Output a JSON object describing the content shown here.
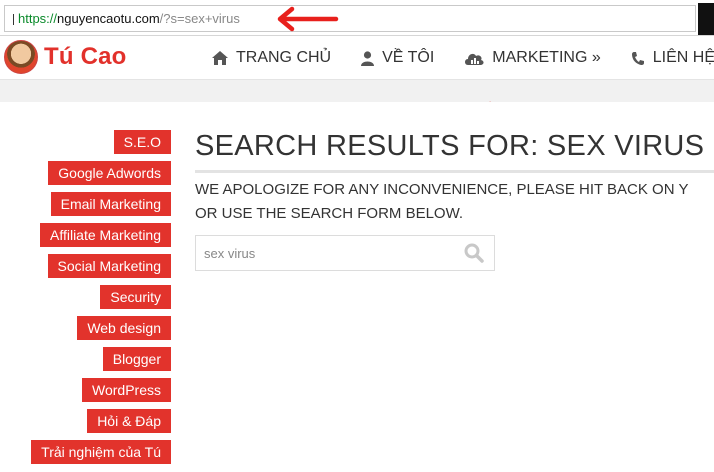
{
  "address_bar": {
    "scheme": "https://",
    "url_main": "nguyencaotu.com",
    "url_rest": "/?s=sex+virus"
  },
  "site": {
    "brand": "Tú Cao"
  },
  "nav": {
    "items": [
      {
        "label": "TRANG CHỦ",
        "icon": "home-icon"
      },
      {
        "label": "VỀ TÔI",
        "icon": "user-icon"
      },
      {
        "label": "MARKETING »",
        "icon": "cloud-chart-icon"
      },
      {
        "label": "LIÊN HỆ",
        "icon": "phone-icon"
      }
    ]
  },
  "categories": [
    "S.E.O",
    "Google Adwords",
    "Email Marketing",
    "Affiliate Marketing",
    "Social Marketing",
    "Security",
    "Web design",
    "Blogger",
    "WordPress",
    "Hỏi & Đáp",
    "Trải nghiệm của Tú"
  ],
  "main": {
    "title": "SEARCH RESULTS FOR: SEX VIRUS",
    "message_line1": "WE APOLOGIZE FOR ANY INCONVENIENCE, PLEASE HIT BACK ON Y",
    "message_line2": "OR USE THE SEARCH FORM BELOW.",
    "search_value": "sex virus"
  },
  "colors": {
    "accent": "#e2332c",
    "annotation": "#e8201c"
  }
}
